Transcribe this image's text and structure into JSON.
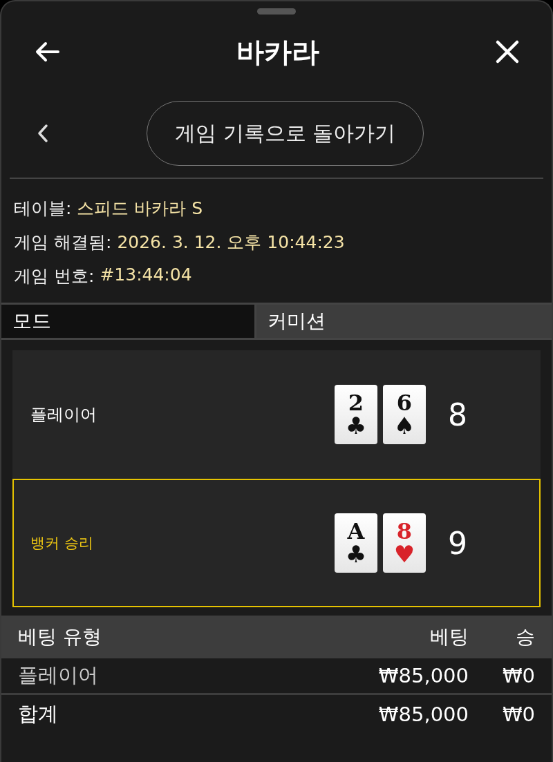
{
  "header": {
    "title": "바카라"
  },
  "back_link": {
    "label": "게임 기록으로 돌아가기"
  },
  "info": [
    {
      "label": "테이블:",
      "value": "스피드 바카라 S"
    },
    {
      "label": "게임 해결됨:",
      "value": "2026. 3. 12. 오후 10:44:23"
    },
    {
      "label": "게임 번호:",
      "value": "#13:44:04"
    }
  ],
  "mode": {
    "label": "모드",
    "value": "커미션"
  },
  "hands": [
    {
      "label": "플레이어",
      "winner": false,
      "total": "8",
      "cards": [
        {
          "rank": "2",
          "suit": "♣",
          "red": false
        },
        {
          "rank": "6",
          "suit": "♠",
          "red": false
        }
      ]
    },
    {
      "label": "뱅커 승리",
      "winner": true,
      "total": "9",
      "cards": [
        {
          "rank": "A",
          "suit": "♣",
          "red": false
        },
        {
          "rank": "8",
          "suit": "♥",
          "red": true
        }
      ]
    }
  ],
  "bets": {
    "columns": [
      "베팅 유형",
      "베팅",
      "승"
    ],
    "rows": [
      {
        "type": "플레이어",
        "bet": "₩85,000",
        "win": "₩0"
      }
    ],
    "total": {
      "type": "합계",
      "bet": "₩85,000",
      "win": "₩0"
    }
  }
}
